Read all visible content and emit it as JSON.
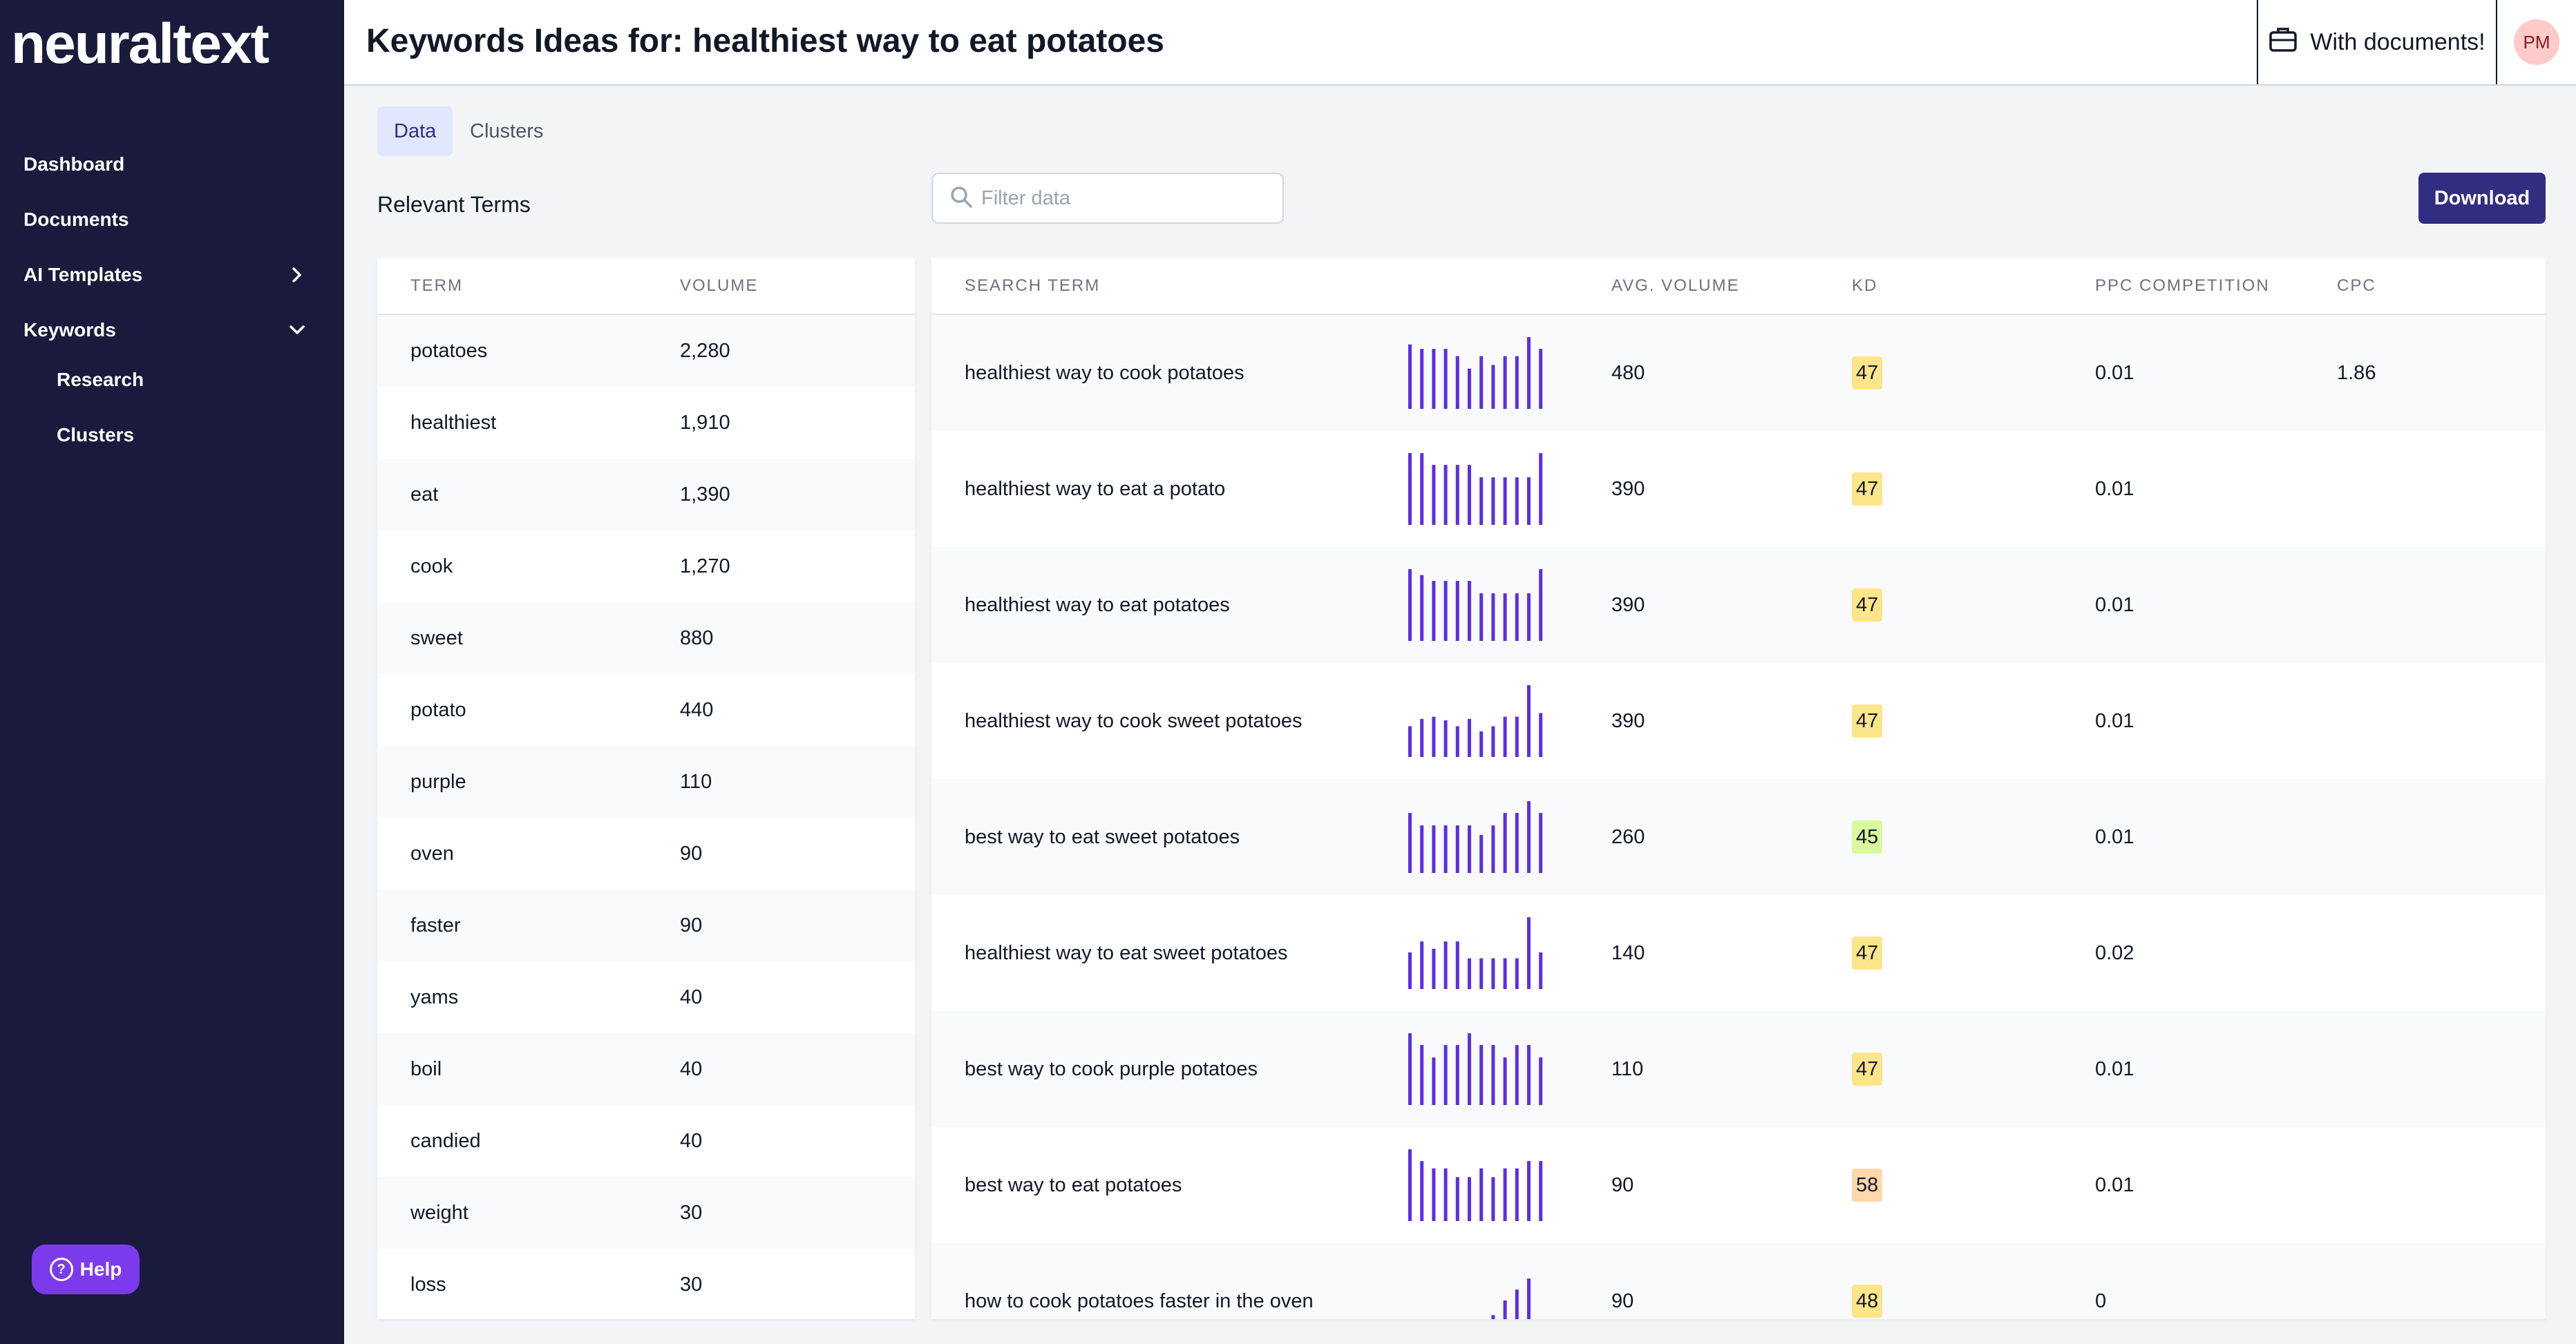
{
  "app": {
    "logo": "neuraltext"
  },
  "sidebar": {
    "items": [
      {
        "label": "Dashboard"
      },
      {
        "label": "Documents"
      },
      {
        "label": "AI Templates"
      },
      {
        "label": "Keywords"
      }
    ],
    "sub_items": [
      {
        "label": "Research"
      },
      {
        "label": "Clusters"
      }
    ],
    "help_label": "Help"
  },
  "header": {
    "title": "Keywords Ideas for: healthiest way to eat potatoes",
    "docs_label": "With documents!",
    "avatar_initials": "PM"
  },
  "tabs": [
    {
      "label": "Data"
    },
    {
      "label": "Clusters"
    }
  ],
  "relevant_terms": {
    "title": "Relevant Terms",
    "headers": {
      "term": "TERM",
      "volume": "VOLUME"
    },
    "rows": [
      {
        "term": "potatoes",
        "volume": "2,280"
      },
      {
        "term": "healthiest",
        "volume": "1,910"
      },
      {
        "term": "eat",
        "volume": "1,390"
      },
      {
        "term": "cook",
        "volume": "1,270"
      },
      {
        "term": "sweet",
        "volume": "880"
      },
      {
        "term": "potato",
        "volume": "440"
      },
      {
        "term": "purple",
        "volume": "110"
      },
      {
        "term": "oven",
        "volume": "90"
      },
      {
        "term": "faster",
        "volume": "90"
      },
      {
        "term": "yams",
        "volume": "40"
      },
      {
        "term": "boil",
        "volume": "40"
      },
      {
        "term": "candied",
        "volume": "40"
      },
      {
        "term": "weight",
        "volume": "30"
      },
      {
        "term": "loss",
        "volume": "30"
      }
    ]
  },
  "filter": {
    "placeholder": "Filter data"
  },
  "download_label": "Download",
  "keywords": {
    "headers": {
      "search_term": "SEARCH TERM",
      "avg_volume": "AVG. VOLUME",
      "kd": "KD",
      "ppc": "PPC COMPETITION",
      "cpc": "CPC"
    },
    "rows": [
      {
        "term": "healthiest way to cook potatoes",
        "volume": "480",
        "kd": "47",
        "kd_color": "#fde68a",
        "ppc": "0.01",
        "cpc": "1.86",
        "trend": [
          0.88,
          0.82,
          0.82,
          0.82,
          0.72,
          0.55,
          0.72,
          0.6,
          0.72,
          0.72,
          0.98,
          0.82
        ]
      },
      {
        "term": "healthiest way to eat a potato",
        "volume": "390",
        "kd": "47",
        "kd_color": "#fde68a",
        "ppc": "0.01",
        "cpc": "",
        "trend": [
          0.98,
          0.98,
          0.82,
          0.82,
          0.82,
          0.82,
          0.65,
          0.65,
          0.65,
          0.65,
          0.65,
          0.98
        ]
      },
      {
        "term": "healthiest way to eat potatoes",
        "volume": "390",
        "kd": "47",
        "kd_color": "#fde68a",
        "ppc": "0.01",
        "cpc": "",
        "trend": [
          0.98,
          0.9,
          0.82,
          0.82,
          0.82,
          0.82,
          0.65,
          0.65,
          0.65,
          0.65,
          0.65,
          0.98
        ]
      },
      {
        "term": "healthiest way to cook sweet potatoes",
        "volume": "390",
        "kd": "47",
        "kd_color": "#fde68a",
        "ppc": "0.01",
        "cpc": "",
        "trend": [
          0.42,
          0.52,
          0.55,
          0.5,
          0.42,
          0.52,
          0.35,
          0.42,
          0.55,
          0.55,
          0.98,
          0.6
        ]
      },
      {
        "term": "best way to eat sweet potatoes",
        "volume": "260",
        "kd": "45",
        "kd_color": "#d9f99d",
        "ppc": "0.01",
        "cpc": "",
        "trend": [
          0.82,
          0.65,
          0.65,
          0.65,
          0.65,
          0.65,
          0.52,
          0.65,
          0.82,
          0.82,
          0.98,
          0.82
        ]
      },
      {
        "term": "healthiest way to eat sweet potatoes",
        "volume": "140",
        "kd": "47",
        "kd_color": "#fde68a",
        "ppc": "0.02",
        "cpc": "",
        "trend": [
          0.5,
          0.65,
          0.55,
          0.65,
          0.65,
          0.42,
          0.42,
          0.42,
          0.42,
          0.42,
          0.98,
          0.5
        ]
      },
      {
        "term": "best way to cook purple potatoes",
        "volume": "110",
        "kd": "47",
        "kd_color": "#fde68a",
        "ppc": "0.01",
        "cpc": "",
        "trend": [
          0.98,
          0.82,
          0.65,
          0.82,
          0.82,
          0.98,
          0.82,
          0.82,
          0.65,
          0.82,
          0.82,
          0.65
        ]
      },
      {
        "term": "best way to eat potatoes",
        "volume": "90",
        "kd": "58",
        "kd_color": "#fed7aa",
        "ppc": "0.01",
        "cpc": "",
        "trend": [
          0.98,
          0.82,
          0.72,
          0.72,
          0.6,
          0.6,
          0.72,
          0.6,
          0.72,
          0.72,
          0.82,
          0.82
        ]
      },
      {
        "term": "how to cook potatoes faster in the oven",
        "volume": "90",
        "kd": "48",
        "kd_color": "#fde68a",
        "ppc": "0",
        "cpc": "",
        "trend": [
          0.05,
          0.12,
          0.05,
          0.12,
          0.05,
          0.12,
          0.05,
          0.3,
          0.5,
          0.65,
          0.8,
          0.2
        ]
      }
    ]
  },
  "colors": {
    "accent": "#312e81",
    "sidebar_bg": "#1a1a3d",
    "spark_bar": "#5b2ee6",
    "help_bg": "#7c3aed"
  }
}
